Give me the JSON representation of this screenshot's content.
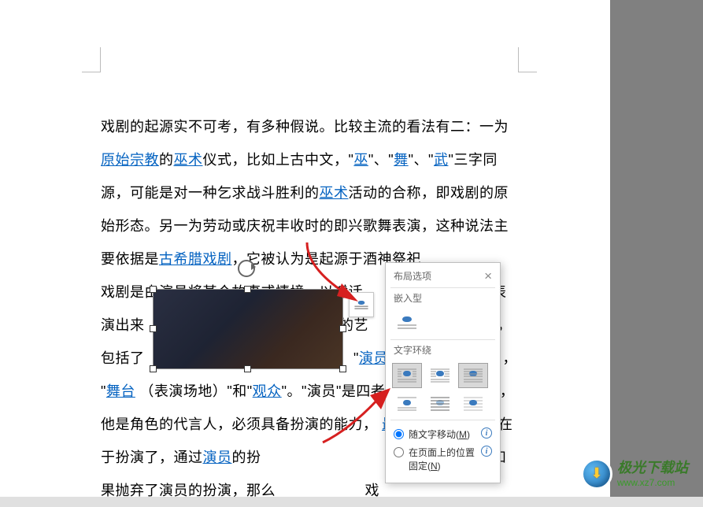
{
  "doc": {
    "p1_a": "戏剧的起源实不可考，有多种假说。比较主流的看法有二：一为",
    "link_religion": "原始宗教",
    "p1_b": "的",
    "link_wushu1": "巫术",
    "p1_c": "仪式，比如上古中文，\"",
    "link_wu": "巫",
    "p1_d": "\"、\"",
    "link_dance": "舞",
    "p1_e": "\"、\"",
    "link_martial": "武",
    "p1_f": "\"三字同源，可能是对一种乞求战斗胜利的",
    "link_wushu2": "巫术",
    "p1_g": "活动的合称，即戏剧的原始形态。另一为劳动或庆祝丰收时的即兴歌舞表演，这种说法主要依据是",
    "link_greece": "古希腊戏剧",
    "p1_h": "，它被认为是起源于酒神祭祀",
    "p2_a": "戏剧是由演员将某个故事或情境，以对话、",
    "p2_b": "表",
    "p2_c": "演出来",
    "p2_d": "的艺",
    "p2_e": "，",
    "p2_f": "包括了",
    "p2_g": "\"",
    "link_actor1": "演员",
    "p2_h": "，",
    "p2_i": "\"",
    "link_stage": "舞台",
    "p2_j": " （表演场地）\"和\"",
    "link_audience": "观众",
    "p2_k": "\"。\"演员\"是四者",
    "p2_l": "，他是角色的代言人，必须具备扮演的能力，",
    "link_biggest": "最大",
    "p2_m": "的不同的处便在于扮演了，通过",
    "link_actor2": "演员",
    "p2_n": "的扮",
    "p2_o": "才能得以伸张，如果抛弃了演员的扮演，那么",
    "p2_p": "戏"
  },
  "popup": {
    "title": "布局选项",
    "section_inline": "嵌入型",
    "section_wrap": "文字环绕",
    "radio_move": "随文字移动(",
    "radio_move_key": "M",
    "radio_move_end": ")",
    "radio_fixed_l1": "在页面上的位置",
    "radio_fixed_l2": "固定(",
    "radio_fixed_key": "N",
    "radio_fixed_end": ")"
  },
  "watermark": {
    "brand": "极光下载站",
    "url": "www.xz7.com"
  }
}
